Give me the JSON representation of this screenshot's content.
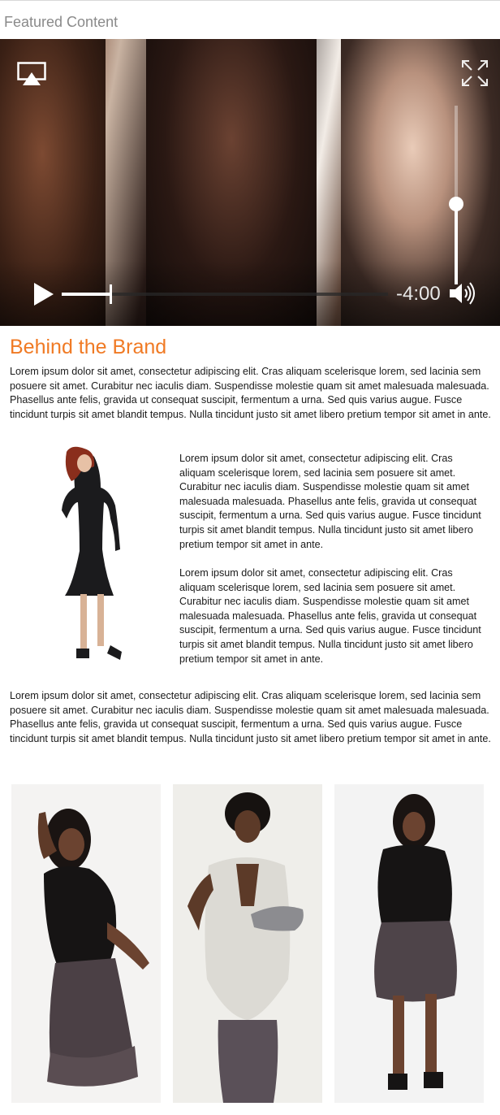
{
  "header": {
    "title": "Featured Content"
  },
  "video_player": {
    "time_remaining": "-4:00",
    "progress_fraction": 0.15,
    "volume_fraction": 0.45,
    "controls": {
      "airplay_icon": "airplay-icon",
      "fullscreen_icon": "fullscreen-expand-icon",
      "play_icon": "play-icon",
      "volume_icon": "speaker-volume-icon"
    }
  },
  "article": {
    "title": "Behind the Brand",
    "paragraphs": [
      "Lorem ipsum dolor sit amet, consectetur adipiscing elit. Cras aliquam scelerisque lorem, sed lacinia sem posuere sit amet. Curabitur nec iaculis diam. Suspendisse molestie quam sit amet malesuada malesuada. Phasellus ante felis, gravida ut consequat suscipit, fermentum a urna. Sed quis varius augue. Fusce tincidunt turpis sit amet blandit tempus. Nulla tincidunt justo sit amet libero pretium tempor sit amet in ante.",
      "Lorem ipsum dolor sit amet, consectetur adipiscing elit. Cras aliquam scelerisque lorem, sed lacinia sem posuere sit amet. Curabitur nec iaculis diam. Suspendisse molestie quam sit amet malesuada malesuada. Phasellus ante felis, gravida ut consequat suscipit, fermentum a urna. Sed quis varius augue. Fusce tincidunt turpis sit amet blandit tempus. Nulla tincidunt justo sit amet libero pretium tempor sit amet in ante.",
      "Lorem ipsum dolor sit amet, consectetur adipiscing elit. Cras aliquam scelerisque lorem, sed lacinia sem posuere sit amet. Curabitur nec iaculis diam. Suspendisse molestie quam sit amet malesuada malesuada. Phasellus ante felis, gravida ut consequat suscipit, fermentum a urna. Sed quis varius augue. Fusce tincidunt turpis sit amet blandit tempus. Nulla tincidunt justo sit amet libero pretium tempor sit amet in ante.",
      "Lorem ipsum dolor sit amet, consectetur adipiscing elit. Cras aliquam scelerisque lorem, sed lacinia sem posuere sit amet. Curabitur nec iaculis diam. Suspendisse molestie quam sit amet malesuada malesuada. Phasellus ante felis, gravida ut consequat suscipit, fermentum a urna. Sed quis varius augue. Fusce tincidunt turpis sit amet blandit tempus. Nulla tincidunt justo sit amet libero pretium tempor sit amet in ante."
    ]
  },
  "colors": {
    "accent": "#f07a24",
    "header_text": "#8a8a8a",
    "body_text": "#1a1a1a"
  }
}
